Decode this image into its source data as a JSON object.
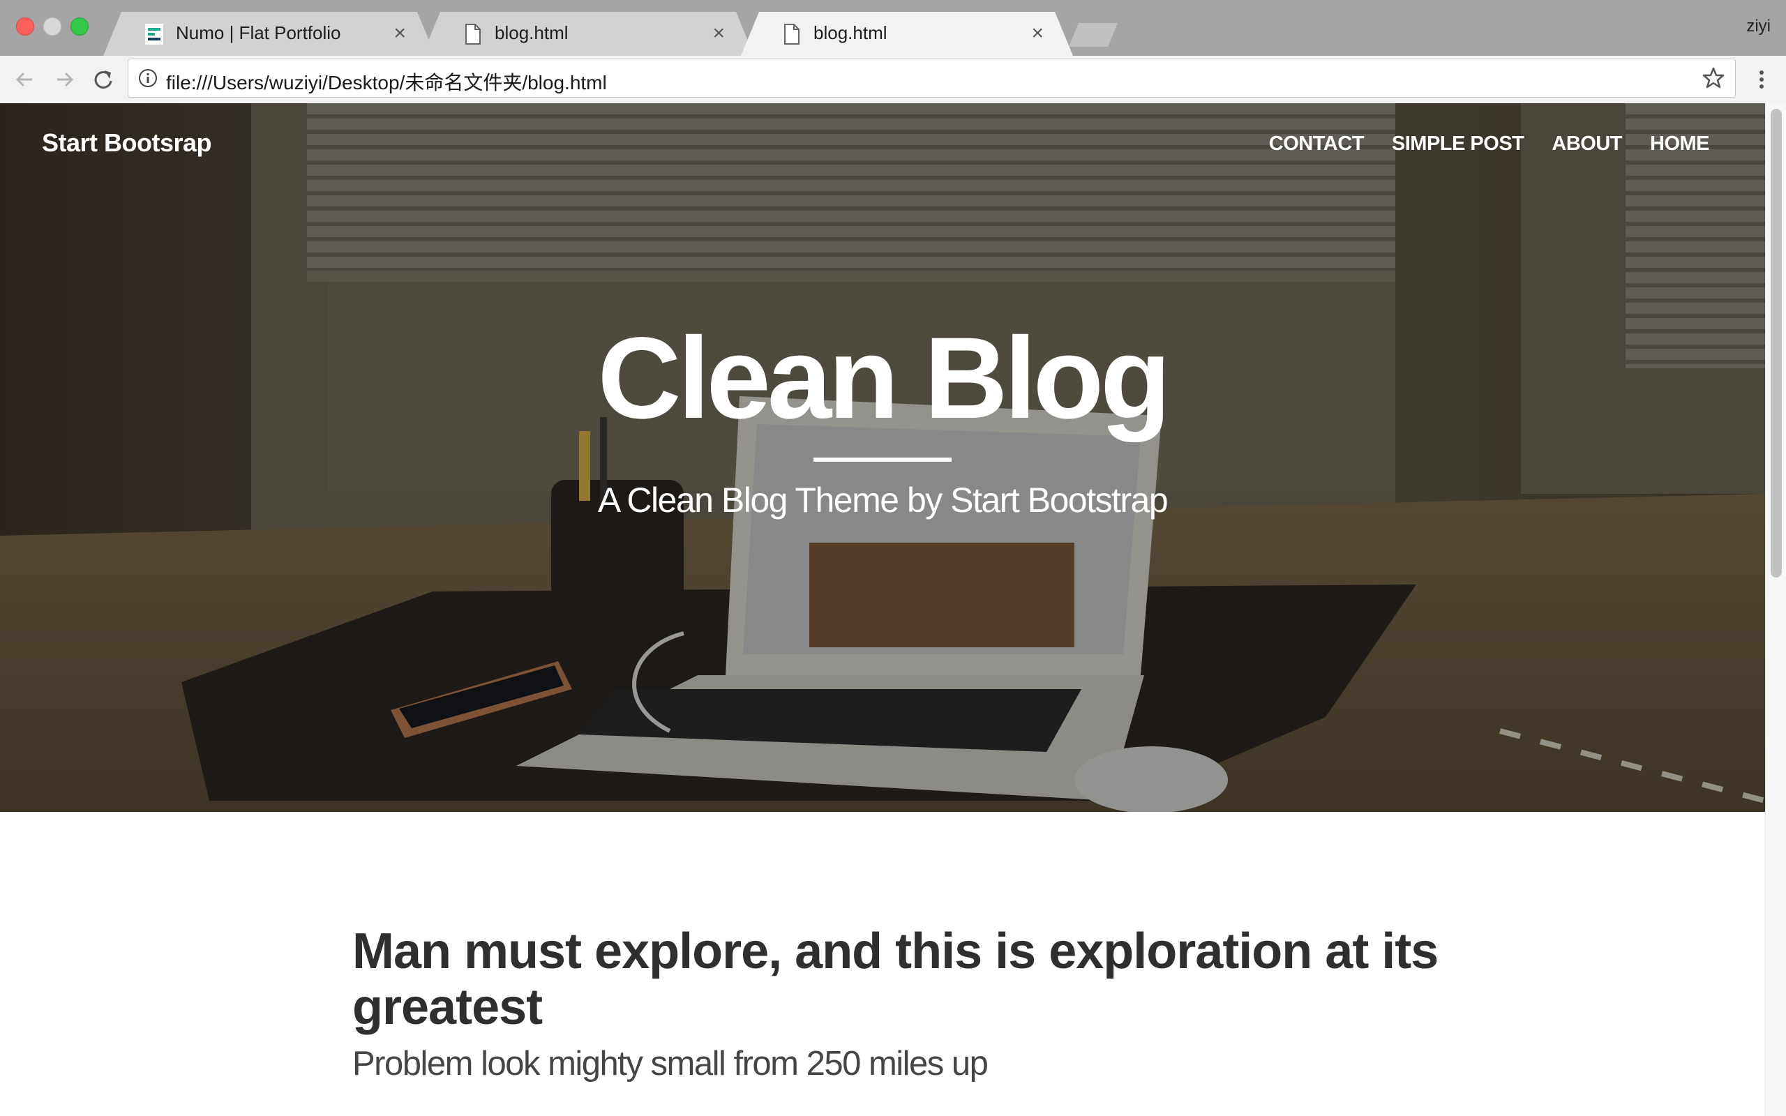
{
  "browser": {
    "tabs": [
      {
        "title": "Numo | Flat Portfolio",
        "close": "×",
        "icon": "numo-favicon-icon"
      },
      {
        "title": "blog.html",
        "close": "×",
        "icon": "document-icon"
      },
      {
        "title": "blog.html",
        "close": "×",
        "icon": "document-icon",
        "active": true
      }
    ],
    "profile_name": "ziyi",
    "url": "file:///Users/wuziyi/Desktop/未命名文件夹/blog.html",
    "icons": {
      "back": "arrow-left-icon",
      "forward": "arrow-right-icon",
      "reload": "reload-icon",
      "info": "info-icon",
      "bookmark": "star-icon",
      "menu": "kebab-menu-icon"
    }
  },
  "site": {
    "brand": "Start Bootsrap",
    "nav": [
      "CONTACT",
      "SIMPLE POST",
      "ABOUT",
      "HOME"
    ],
    "hero": {
      "title": "Clean Blog",
      "subtitle": "A Clean Blog Theme by Start Bootstrap"
    },
    "post": {
      "title": "Man must explore, and this is exploration at its greatest",
      "subtitle": "Problem look mighty small from 250 miles up"
    }
  },
  "colors": {
    "tabstrip": "#a5a5a5",
    "toolbar": "#f2f2f2",
    "post_title": "#2f2f2f",
    "hero_text": "#ffffff"
  }
}
